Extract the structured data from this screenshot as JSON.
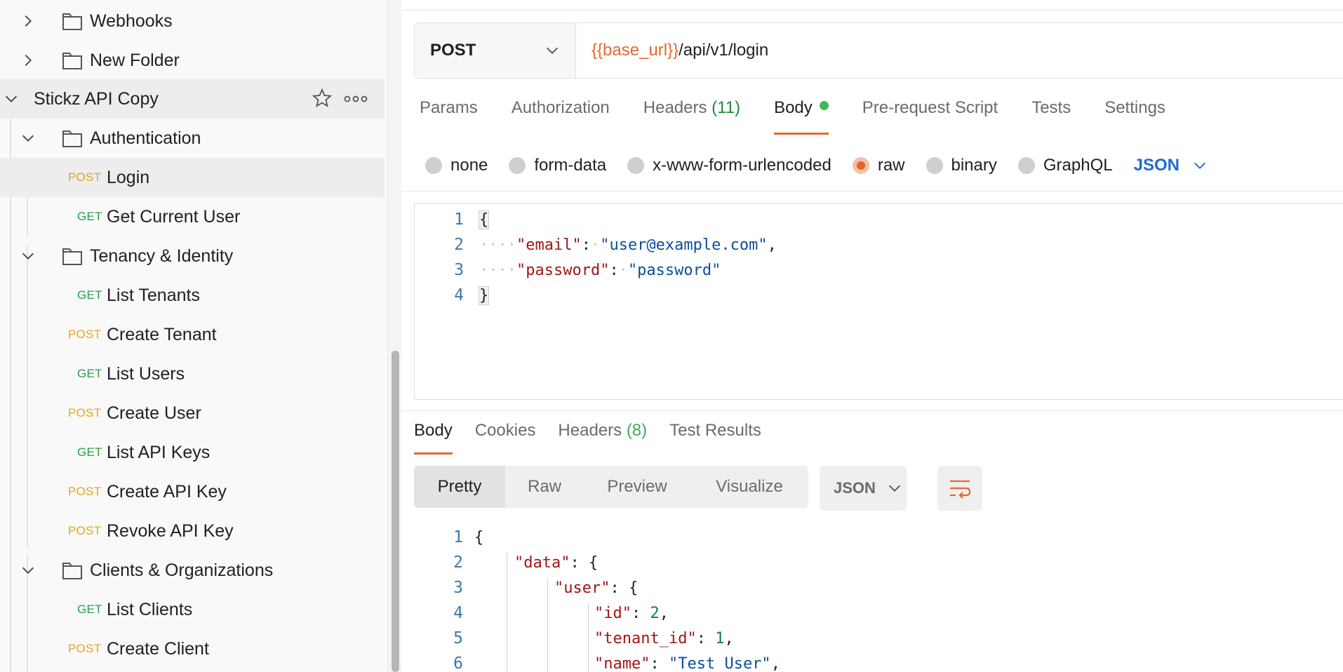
{
  "sidebar": {
    "items": [
      {
        "kind": "folder",
        "label": "Webhooks",
        "expanded": false
      },
      {
        "kind": "folder",
        "label": "New Folder",
        "expanded": false
      },
      {
        "kind": "collection",
        "label": "Stickz API Copy",
        "expanded": true
      },
      {
        "kind": "folder",
        "label": "Authentication",
        "expanded": true
      },
      {
        "kind": "request",
        "method": "POST",
        "label": "Login",
        "selected": true
      },
      {
        "kind": "request",
        "method": "GET",
        "label": "Get Current User"
      },
      {
        "kind": "folder",
        "label": "Tenancy & Identity",
        "expanded": true
      },
      {
        "kind": "request",
        "method": "GET",
        "label": "List Tenants"
      },
      {
        "kind": "request",
        "method": "POST",
        "label": "Create Tenant"
      },
      {
        "kind": "request",
        "method": "GET",
        "label": "List Users"
      },
      {
        "kind": "request",
        "method": "POST",
        "label": "Create User"
      },
      {
        "kind": "request",
        "method": "GET",
        "label": "List API Keys"
      },
      {
        "kind": "request",
        "method": "POST",
        "label": "Create API Key"
      },
      {
        "kind": "request",
        "method": "POST",
        "label": "Revoke API Key"
      },
      {
        "kind": "folder",
        "label": "Clients & Organizations",
        "expanded": true
      },
      {
        "kind": "request",
        "method": "GET",
        "label": "List Clients"
      },
      {
        "kind": "request",
        "method": "POST",
        "label": "Create Client"
      }
    ]
  },
  "request": {
    "method": "POST",
    "url_var": "{{base_url}}",
    "url_path": "/api/v1/login",
    "tabs": {
      "params": "Params",
      "authorization": "Authorization",
      "headers": "Headers",
      "headers_count": "(11)",
      "body": "Body",
      "prerequest": "Pre-request Script",
      "tests": "Tests",
      "settings": "Settings"
    },
    "body_types": {
      "none": "none",
      "form_data": "form-data",
      "urlencoded": "x-www-form-urlencoded",
      "raw": "raw",
      "binary": "binary",
      "graphql": "GraphQL"
    },
    "body_format": "JSON",
    "body_lines": {
      "l1": {
        "num": "1",
        "text": "{"
      },
      "l2": {
        "num": "2",
        "key": "\"email\"",
        "value": "\"user@example.com\""
      },
      "l3": {
        "num": "3",
        "key": "\"password\"",
        "value": "\"password\""
      },
      "l4": {
        "num": "4",
        "text": "}"
      }
    }
  },
  "response": {
    "tabs": {
      "body": "Body",
      "cookies": "Cookies",
      "headers": "Headers",
      "headers_count": "(8)",
      "test_results": "Test Results"
    },
    "views": {
      "pretty": "Pretty",
      "raw": "Raw",
      "preview": "Preview",
      "visualize": "Visualize"
    },
    "format": "JSON",
    "lines": {
      "l1": {
        "num": "1",
        "text": "{"
      },
      "l2": {
        "num": "2",
        "key": "\"data\"",
        "rest": ": {"
      },
      "l3": {
        "num": "3",
        "key": "\"user\"",
        "rest": ": {"
      },
      "l4": {
        "num": "4",
        "key": "\"id\"",
        "value": "2"
      },
      "l5": {
        "num": "5",
        "key": "\"tenant_id\"",
        "value": "1"
      },
      "l6": {
        "num": "6",
        "key": "\"name\"",
        "value": "\"Test User\""
      }
    }
  },
  "colors": {
    "accent": "#e36a33",
    "post": "#e5a61c",
    "get": "#29a04a",
    "link_blue": "#1f6bd6"
  }
}
